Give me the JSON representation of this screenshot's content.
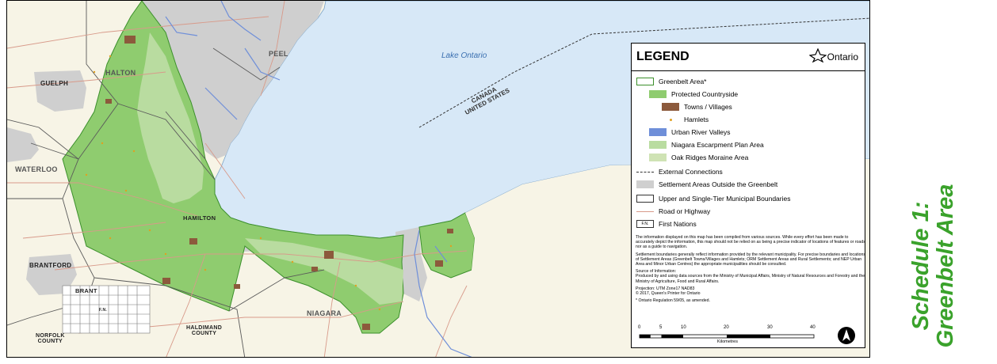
{
  "map": {
    "lake_label": "Lake Ontario",
    "border_label_top": "CANADA",
    "border_label_bottom": "UNITED STATES",
    "place_labels": {
      "halton": "HALTON",
      "peel": "PEEL",
      "guelph": "GUELPH",
      "waterloo": "WATERLOO",
      "hamilton": "HAMILTON",
      "brantford": "BRANTFORD",
      "brant": "BRANT",
      "norfolk": "NORFOLK\nCOUNTY",
      "haldimand": "HALDIMAND\nCOUNTY",
      "niagara": "NIAGARA",
      "fn": "F.N."
    },
    "colors": {
      "lake": "#d7e8f7",
      "land": "#f7f4e6",
      "greenbelt": "#8fcc6f",
      "niagara_escarpment": "#b9dca0",
      "settlement": "#cfcfcf",
      "towns": "#8c5a3c",
      "river": "#6f8fd9",
      "roads": "#d89a8a"
    }
  },
  "legend": {
    "title": "LEGEND",
    "logo_text": "Ontario",
    "items": [
      {
        "label": "Greenbelt Area*",
        "swatch": "outline-green"
      },
      {
        "label": "Protected Countryside",
        "swatch": "green"
      },
      {
        "label": "Towns / Villages",
        "swatch": "brown"
      },
      {
        "label": "Hamlets",
        "swatch": "dot"
      },
      {
        "label": "Urban River Valleys",
        "swatch": "blue"
      },
      {
        "label": "Niagara Escarpment Plan Area",
        "swatch": "light-green"
      },
      {
        "label": "Oak Ridges Moraine Area",
        "swatch": "pale-green"
      },
      {
        "label": "External Connections",
        "swatch": "dashed"
      },
      {
        "label": "Settlement Areas Outside the Greenbelt",
        "swatch": "grey"
      },
      {
        "label": "Upper and Single-Tier Municipal Boundaries",
        "swatch": "outline-grey"
      },
      {
        "label": "Road or Highway",
        "swatch": "road"
      },
      {
        "label": "First Nations",
        "swatch": "fn"
      }
    ],
    "fn_swatch_text": "F.N.",
    "notes": [
      "The information displayed on this map has been compiled from various sources. While every effort has been made to accurately depict the information, this map should not be relied on as being a precise indicator of locations of features or roads nor as a guide to navigation.",
      "Settlement boundaries generally reflect information provided by the relevant municipality. For precise boundaries and locations of Settlement Areas (Greenbelt Towns/Villages and Hamlets; ORM Settlement Areas and Rural Settlements; and NEP Urban Area and Minor Urban Centres) the appropriate municipalities should be consulted.",
      "Source of Information:\nProduced by and using data sources from the Ministry of Municipal Affairs, Ministry of Natural Resources and Forestry and the Ministry of Agriculture, Food and Rural Affairs.",
      "Projection: UTM Zone17 NAD83\n© 2017, Queen's Printer for Ontario",
      "* Ontario Regulation 59/05, as amended."
    ],
    "scale": {
      "ticks": [
        "0",
        "5",
        "10",
        "20",
        "30",
        "40"
      ],
      "units": "Kilometres"
    }
  },
  "schedule": {
    "line1": "Schedule 1:",
    "line2": "Greenbelt Area"
  }
}
